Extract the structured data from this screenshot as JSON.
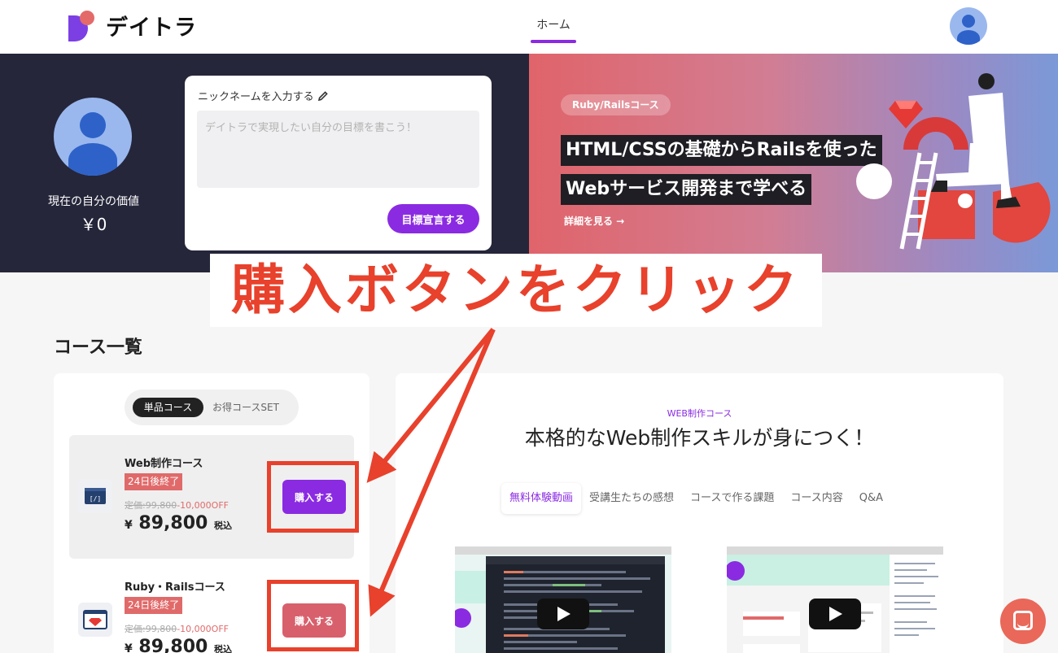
{
  "header": {
    "logo_text": "デイトラ",
    "nav_home": "ホーム",
    "icons": {
      "avatar": "user-avatar-icon"
    }
  },
  "profile": {
    "value_label": "現在の自分の価値",
    "value_amount": "￥0"
  },
  "goal": {
    "nickname_label": "ニックネームを入力する",
    "placeholder": "デイトラで実現したい自分の目標を書こう！",
    "submit_label": "目標宣言する"
  },
  "banner": {
    "tag": "Ruby/Railsコース",
    "line1": "HTML/CSSの基礎からRailsを使った",
    "line2": "Webサービス開発まで学べる",
    "more": "詳細を見る →"
  },
  "annotation": {
    "text": "購入ボタンをクリック",
    "color": "#e8412c"
  },
  "courses": {
    "section_title": "コース一覧",
    "toggle": {
      "single": "単品コース",
      "set": "お得コースSET"
    },
    "items": [
      {
        "name": "Web制作コース",
        "badge": "24日後終了",
        "list_price": "定価:99,800",
        "discount": "-10,000OFF",
        "price_yen": "¥",
        "price": "89,800",
        "tax": "税込",
        "buy_label": "購入する",
        "icon": "code-window-icon"
      },
      {
        "name": "Ruby・Railsコース",
        "badge": "24日後終了",
        "list_price": "定価:99,800",
        "discount": "-10,000OFF",
        "price_yen": "¥",
        "price": "89,800",
        "tax": "税込",
        "buy_label": "購入する",
        "icon": "ruby-gem-icon"
      }
    ]
  },
  "detail": {
    "tag": "WEB制作コース",
    "title": "本格的なWeb制作スキルが身につく！",
    "tabs": [
      "無料体験動画",
      "受講生たちの感想",
      "コースで作る課題",
      "コース内容",
      "Q&A"
    ],
    "active_tab": "無料体験動画"
  },
  "colors": {
    "accent": "#8a2be2",
    "badge": "#e06a6a",
    "hero_dark": "#25263a",
    "annotation": "#e8412c"
  }
}
